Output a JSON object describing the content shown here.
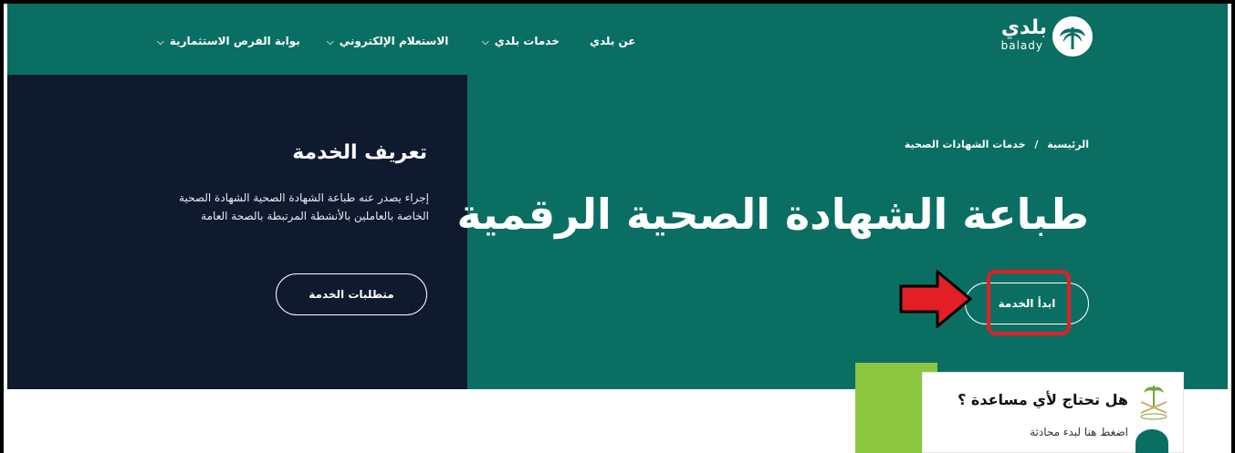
{
  "header": {
    "logo_ar": "بلدي",
    "logo_en": "balady",
    "nav": [
      {
        "label": "عن بلدي"
      },
      {
        "label": "خدمات بلدي"
      },
      {
        "label": "الاستعلام الإلكتروني"
      },
      {
        "label": "بوابة الفرص الاستثمارية"
      }
    ]
  },
  "service_definition": {
    "title": "تعريف الخدمة",
    "description": "إجراء يصدر عنه طباعة الشهادة الصحية الشهادة الصحية الخاصة بالعاملين بالأنشطة المرتبطة بالصحة العامة",
    "requirements_button": "متطلبات الخدمة"
  },
  "breadcrumb": {
    "home": "الرئيسية",
    "separator": "/",
    "current": "خدمات الشهادات الصحية"
  },
  "main": {
    "title": "طباعة الشهادة الصحية الرقمية",
    "start_button": "ابدأ الخدمة"
  },
  "help": {
    "title": "هل تحتاج لأي مساعدة ؟",
    "subtitle": "اضغط هنا لبدء محادثة"
  },
  "colors": {
    "teal": "#0b6e63",
    "navy": "#0f1a2e",
    "highlight_red": "#e31e24",
    "green": "#8cc540"
  }
}
